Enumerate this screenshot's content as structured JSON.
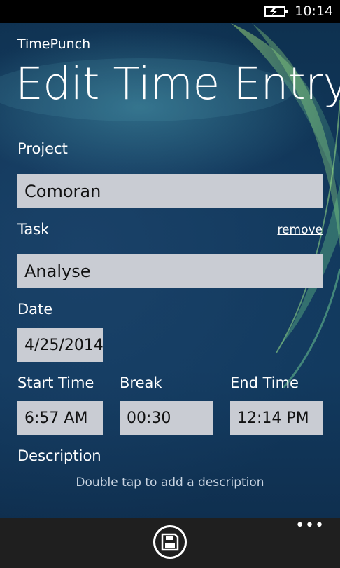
{
  "status_bar": {
    "time": "10:14",
    "battery_icon": "battery-charging-icon"
  },
  "header": {
    "app_name": "TimePunch",
    "title": "Edit Time Entry"
  },
  "form": {
    "project": {
      "label": "Project",
      "value": "Comoran"
    },
    "task": {
      "label": "Task",
      "remove_label": "remove",
      "value": "Analyse"
    },
    "date": {
      "label": "Date",
      "value": "4/25/2014"
    },
    "start_time": {
      "label": "Start Time",
      "value": "6:57 AM"
    },
    "break": {
      "label": "Break",
      "value": "00:30"
    },
    "end_time": {
      "label": "End Time",
      "value": "12:14 PM"
    },
    "description": {
      "label": "Description",
      "hint": "Double tap to add a description"
    }
  },
  "app_bar": {
    "save_icon": "save-icon",
    "more_label": "•••"
  },
  "colors": {
    "field_bg": "#c9ccd3",
    "background": "#123a5f",
    "app_bar": "#1f1f1f"
  }
}
